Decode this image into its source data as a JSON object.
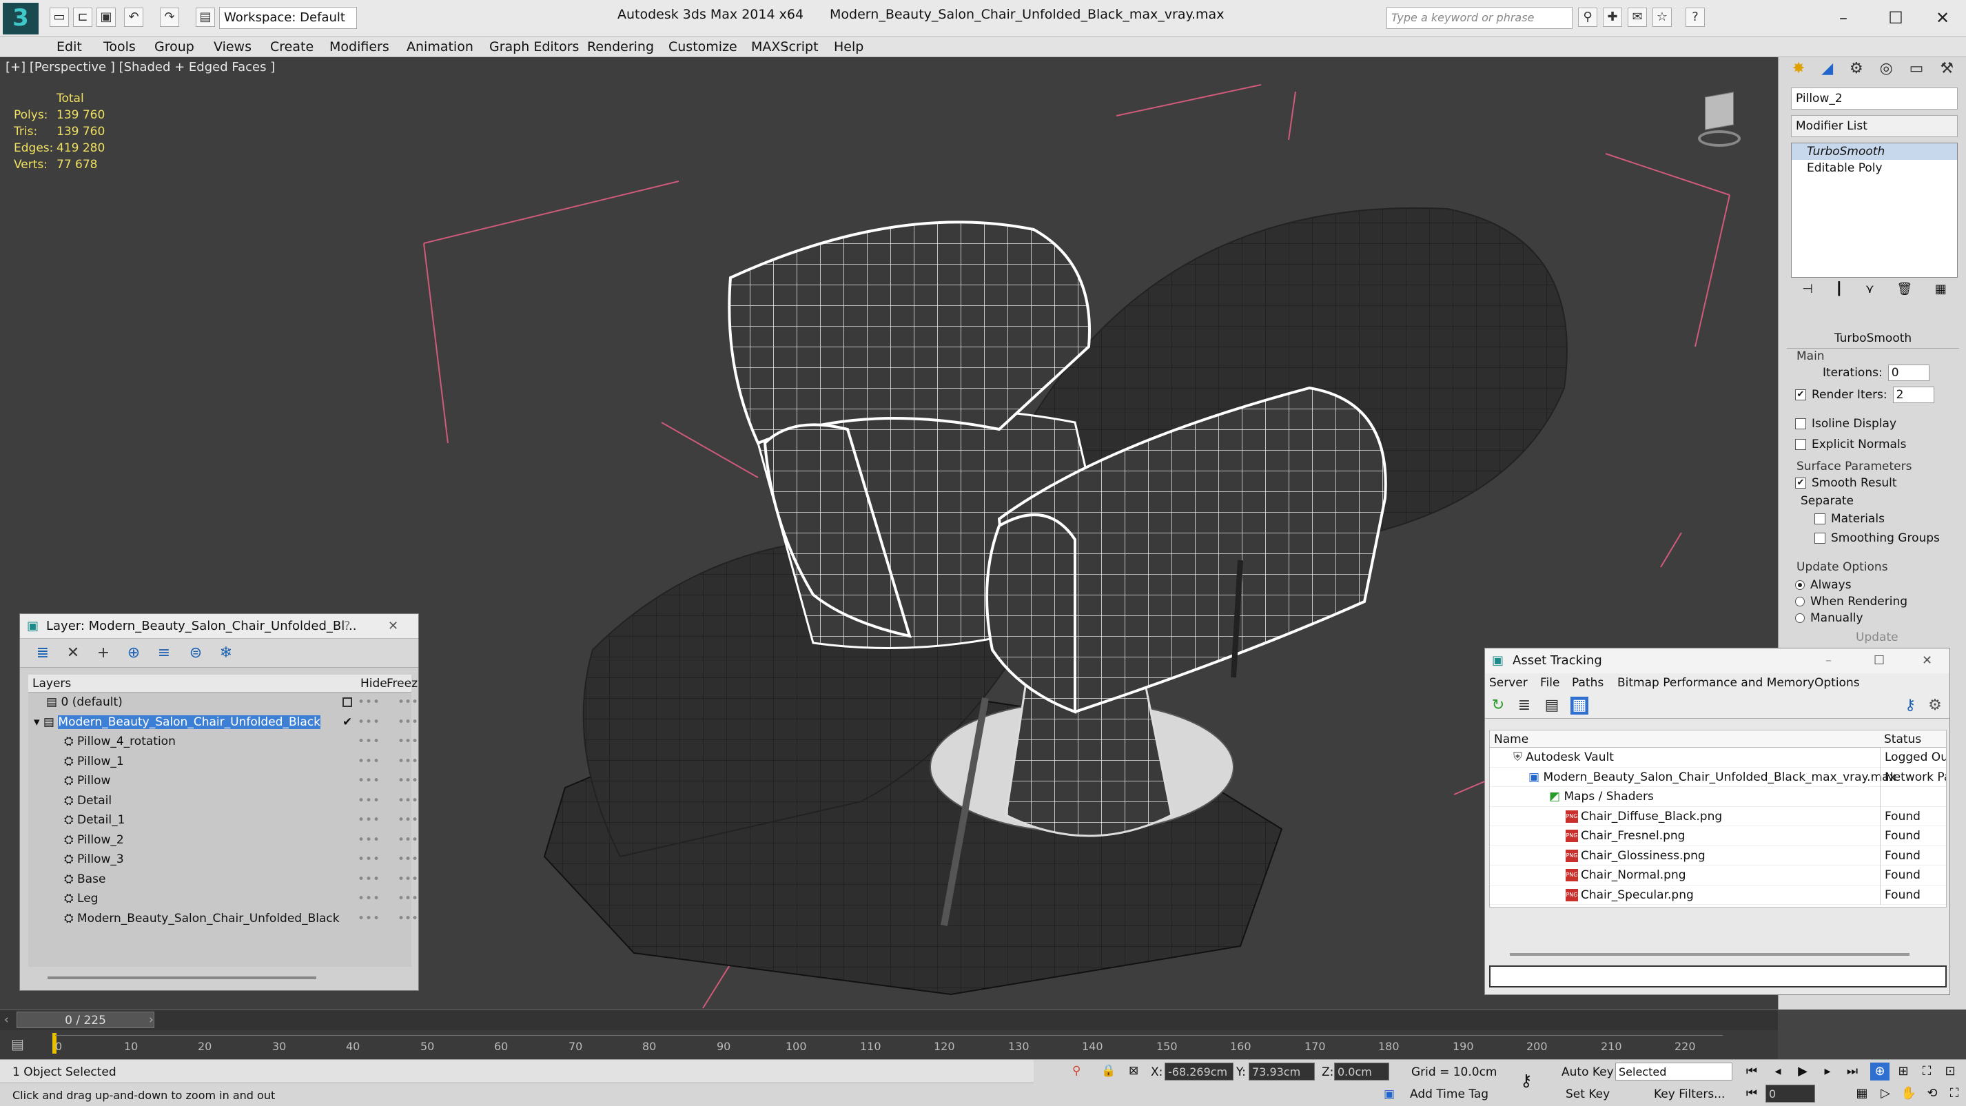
{
  "titlebar": {
    "app": "Autodesk 3ds Max  2014 x64",
    "file": "Modern_Beauty_Salon_Chair_Unfolded_Black_max_vray.max",
    "workspace": "Workspace: Default",
    "search_placeholder": "Type a keyword or phrase"
  },
  "menu": [
    "Edit",
    "Tools",
    "Group",
    "Views",
    "Create",
    "Modifiers",
    "Animation",
    "Graph Editors",
    "Rendering",
    "Customize",
    "MAXScript",
    "Help"
  ],
  "viewport": {
    "label": "[+] [Perspective ] [Shaded + Edged Faces ]",
    "stats": {
      "title": "Total",
      "rows": [
        {
          "k": "Polys:",
          "v": "139 760"
        },
        {
          "k": "Tris:",
          "v": "139 760"
        },
        {
          "k": "Edges:",
          "v": "419 280"
        },
        {
          "k": "Verts:",
          "v": "77 678"
        }
      ]
    }
  },
  "panel": {
    "object_name": "Pillow_2",
    "modifier_list": "Modifier List",
    "stack": [
      "TurboSmooth",
      "Editable Poly"
    ],
    "rollout": "TurboSmooth",
    "main": "Main",
    "iterations_label": "Iterations:",
    "iterations": "0",
    "render_iters_label": "Render Iters:",
    "render_iters": "2",
    "isoline": "Isoline Display",
    "explicit": "Explicit Normals",
    "surface": "Surface Parameters",
    "smooth": "Smooth Result",
    "separate": "Separate",
    "materials": "Materials",
    "smoothing": "Smoothing Groups",
    "update_opts": "Update Options",
    "always": "Always",
    "when_rendering": "When Rendering",
    "manually": "Manually",
    "update": "Update"
  },
  "layers": {
    "title": "Layer: Modern_Beauty_Salon_Chair_Unfolded_Bl...",
    "help": "?",
    "col_layers": "Layers",
    "col_hide": "Hide",
    "col_freeze": "Freez",
    "rows": [
      {
        "name": "0 (default)",
        "indent": 1
      },
      {
        "name": "Modern_Beauty_Salon_Chair_Unfolded_Black",
        "indent": 1,
        "sel": true
      },
      {
        "name": "Pillow_4_rotation",
        "indent": 2
      },
      {
        "name": "Pillow_1",
        "indent": 2
      },
      {
        "name": "Pillow",
        "indent": 2
      },
      {
        "name": "Detail",
        "indent": 2
      },
      {
        "name": "Detail_1",
        "indent": 2
      },
      {
        "name": "Pillow_2",
        "indent": 2
      },
      {
        "name": "Pillow_3",
        "indent": 2
      },
      {
        "name": "Base",
        "indent": 2
      },
      {
        "name": "Leg",
        "indent": 2
      },
      {
        "name": "Modern_Beauty_Salon_Chair_Unfolded_Black",
        "indent": 2
      }
    ]
  },
  "assets": {
    "title": "Asset Tracking",
    "menu": [
      "Server",
      "File",
      "Paths",
      "Bitmap Performance and Memory",
      "Options"
    ],
    "col_name": "Name",
    "col_status": "Status",
    "rows": [
      {
        "name": "Autodesk Vault",
        "status": "Logged Ou",
        "indent": 1
      },
      {
        "name": "Modern_Beauty_Salon_Chair_Unfolded_Black_max_vray.max",
        "status": "Network Pa",
        "indent": 2
      },
      {
        "name": "Maps / Shaders",
        "status": "",
        "indent": 3
      },
      {
        "name": "Chair_Diffuse_Black.png",
        "status": "Found",
        "indent": 4,
        "png": true
      },
      {
        "name": "Chair_Fresnel.png",
        "status": "Found",
        "indent": 4,
        "png": true
      },
      {
        "name": "Chair_Glossiness.png",
        "status": "Found",
        "indent": 4,
        "png": true
      },
      {
        "name": "Chair_Normal.png",
        "status": "Found",
        "indent": 4,
        "png": true
      },
      {
        "name": "Chair_Specular.png",
        "status": "Found",
        "indent": 4,
        "png": true
      }
    ]
  },
  "timeline": {
    "frame": "0 / 225",
    "ticks": [
      "0",
      "10",
      "20",
      "30",
      "40",
      "50",
      "60",
      "70",
      "80",
      "90",
      "100",
      "110",
      "120",
      "130",
      "140",
      "150",
      "160",
      "170",
      "180",
      "190",
      "200",
      "210",
      "220"
    ]
  },
  "status": {
    "selected": "1 Object Selected",
    "hint": "Click and drag up-and-down to zoom in and out",
    "x_label": "X:",
    "x": "-68.269cm",
    "y_label": "Y:",
    "y": "73.93cm",
    "z_label": "Z:",
    "z": "0.0cm",
    "grid": "Grid = 10.0cm",
    "auto_key": "Auto Key",
    "set_key": "Set Key",
    "key_mode": "Selected",
    "key_filters": "Key Filters...",
    "add_time_tag": "Add Time Tag",
    "frame_field": "0"
  }
}
